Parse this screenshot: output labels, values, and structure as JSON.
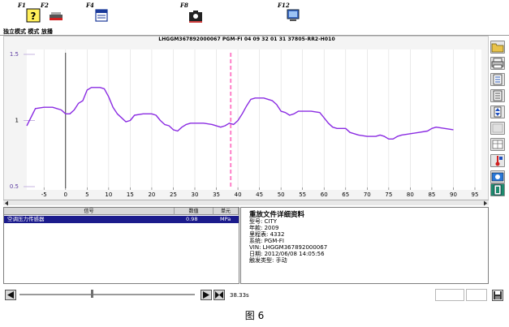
{
  "toolbar": {
    "keys": [
      {
        "label": "F1",
        "icon": "help-icon"
      },
      {
        "label": "F2",
        "icon": "device-icon"
      },
      {
        "label": "F4",
        "icon": "data-list-icon"
      },
      {
        "label": "F8",
        "icon": "snapshot-icon"
      },
      {
        "label": "F12",
        "icon": "monitor-icon"
      }
    ],
    "mode_text": "独立模式 模式 放播"
  },
  "chart_title": "LHGGM367892000067 PGM-FI 04 09 32 01 31 37805-RR2-H010",
  "chart_data": {
    "type": "line",
    "x_ticks": [
      -5,
      0,
      5,
      10,
      15,
      20,
      25,
      30,
      35,
      40,
      45,
      50,
      55,
      60,
      65,
      70,
      75,
      80,
      85,
      90,
      95
    ],
    "y_ticks": [
      "1.5",
      "1",
      "0.5"
    ],
    "xlim": [
      -9,
      95
    ],
    "ylim": [
      0.5,
      1.5
    ],
    "cursor_x": 38.33,
    "zero_marker_x": 0,
    "grid": true,
    "line_color": "#8a2be2",
    "series": [
      {
        "x": [
          -9,
          -7,
          -5,
          -3,
          -1,
          0,
          1,
          2,
          3,
          4,
          5,
          6,
          8,
          9,
          10,
          11,
          12,
          13,
          14,
          15,
          16,
          18,
          20,
          21,
          22,
          23,
          24,
          25,
          26,
          27,
          28,
          29,
          30,
          32,
          34,
          36,
          37,
          38,
          39,
          40,
          41,
          42,
          43,
          44,
          45,
          46,
          47,
          48,
          49,
          50,
          51,
          52,
          53,
          54,
          55,
          57,
          59,
          60,
          61,
          62,
          63,
          64,
          65,
          66,
          67,
          68,
          70,
          71,
          72,
          73,
          74,
          75,
          76,
          77,
          78,
          80,
          82,
          84,
          85,
          86,
          88,
          90
        ],
        "y": [
          0.96,
          1.09,
          1.1,
          1.1,
          1.08,
          1.05,
          1.05,
          1.08,
          1.13,
          1.15,
          1.23,
          1.25,
          1.25,
          1.24,
          1.18,
          1.1,
          1.05,
          1.02,
          0.99,
          1.0,
          1.04,
          1.05,
          1.05,
          1.04,
          1.0,
          0.97,
          0.96,
          0.93,
          0.92,
          0.95,
          0.97,
          0.98,
          0.98,
          0.98,
          0.97,
          0.95,
          0.96,
          0.98,
          0.97,
          1.0,
          1.05,
          1.11,
          1.16,
          1.17,
          1.17,
          1.17,
          1.16,
          1.15,
          1.12,
          1.07,
          1.06,
          1.04,
          1.05,
          1.07,
          1.07,
          1.07,
          1.06,
          1.02,
          0.98,
          0.95,
          0.94,
          0.94,
          0.94,
          0.91,
          0.9,
          0.89,
          0.88,
          0.88,
          0.88,
          0.89,
          0.88,
          0.86,
          0.86,
          0.88,
          0.89,
          0.9,
          0.91,
          0.92,
          0.94,
          0.95,
          0.94,
          0.93
        ]
      }
    ]
  },
  "signal_table": {
    "headers": [
      "信号",
      "数值",
      "单元"
    ],
    "rows": [
      {
        "name": "空调压力传感器",
        "value": "0.98",
        "unit": "MPa"
      }
    ]
  },
  "details": {
    "title": "重放文件详细资料",
    "lines": [
      "型号: CITY",
      "年款: 2009",
      "里程表: 4332",
      "系统: PGM-FI",
      "VIN: LHGGM367892000067",
      "日期: 2012/06/08 14:05:56",
      "触发类型: 手动"
    ]
  },
  "playback": {
    "time": "38.33s"
  },
  "caption": "图 6"
}
